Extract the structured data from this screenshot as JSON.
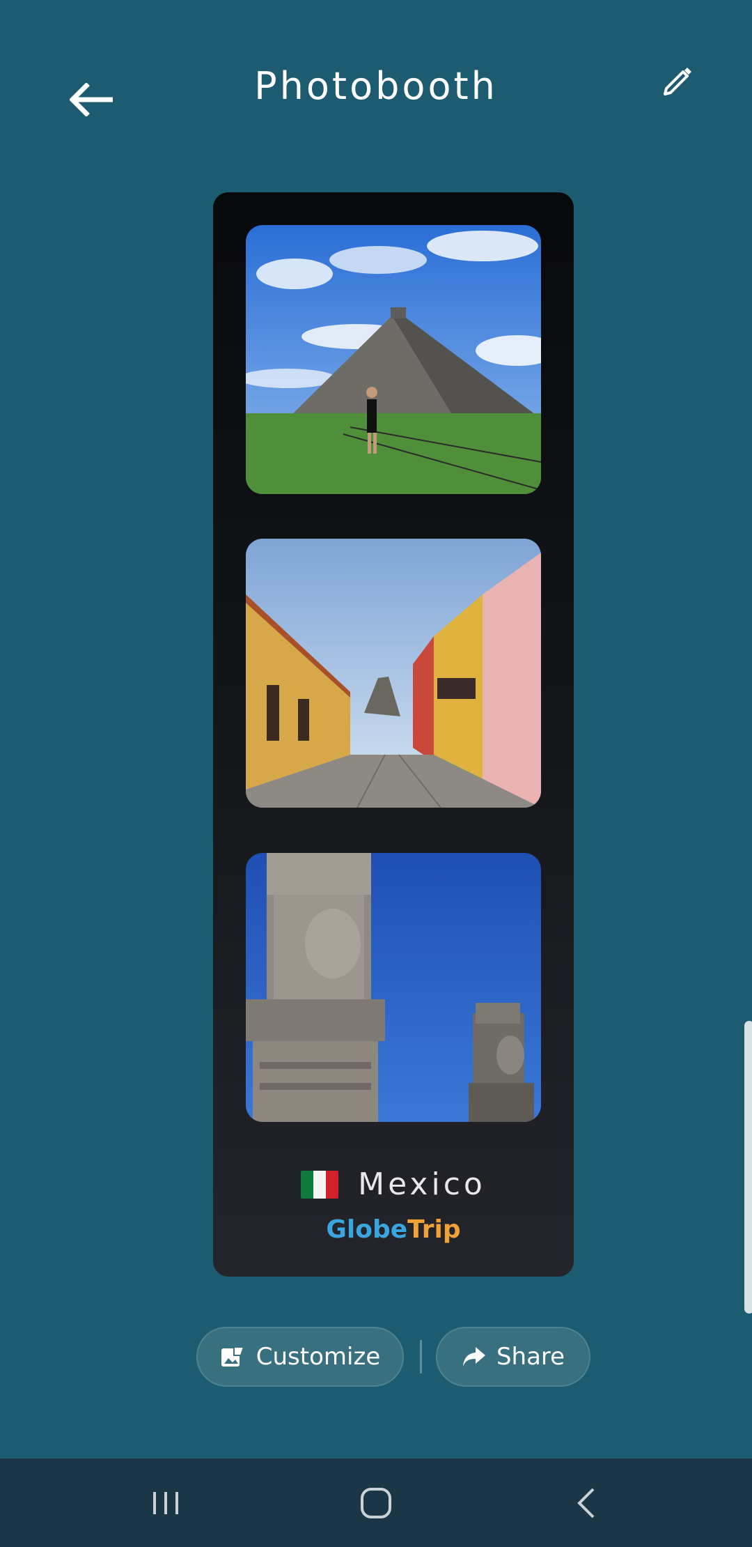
{
  "header": {
    "title": "Photobooth",
    "back_icon": "arrow-left-icon",
    "edit_icon": "pencil-icon"
  },
  "strip": {
    "photos": [
      {
        "subject": "pyramid-photo"
      },
      {
        "subject": "street-photo"
      },
      {
        "subject": "statues-photo"
      }
    ],
    "caption": {
      "flag_icon": "mexico-flag-icon",
      "country": "Mexico"
    },
    "brand": {
      "part1": "Globe",
      "part2": "Trip",
      "color1": "#3aa6df",
      "color2": "#f0a238"
    }
  },
  "actions": {
    "customize_label": "Customize",
    "share_label": "Share",
    "customize_icon": "customize-icon",
    "share_icon": "share-icon"
  },
  "nav": {
    "recent_icon": "recent-apps-icon",
    "home_icon": "home-icon",
    "back_icon": "back-icon"
  },
  "colors": {
    "background": "#1d5c70",
    "navbar": "#1b3747",
    "pill": "#39707f"
  }
}
